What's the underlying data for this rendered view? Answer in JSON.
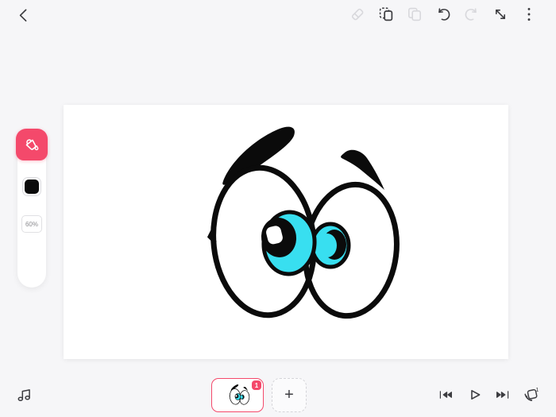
{
  "colors": {
    "background": "#f6f6f8",
    "canvas": "#ffffff",
    "accent_pink": "#f4496b",
    "iris_cyan": "#38dff0",
    "ink_black": "#0b0b0b",
    "icon_dark": "#3d3d41",
    "icon_disabled": "#d8d8dc"
  },
  "top_bar": {
    "icons": [
      "back",
      "eraser",
      "paste",
      "copy",
      "undo",
      "redo",
      "resize-diagonal",
      "more-menu"
    ]
  },
  "left_toolbar": {
    "active_tool": "fill-bucket",
    "color_swatch": "#0b0b0b",
    "opacity_label": "60%"
  },
  "canvas": {
    "drawing": "cartoon-eyes-with-eyebrows"
  },
  "bottom_bar": {
    "music_icon": "music-note",
    "frame_badge": "1",
    "add_frame_label": "+",
    "playback_icons": [
      "skip-to-start",
      "play",
      "skip-to-end"
    ],
    "onion_layers_count": "1"
  }
}
